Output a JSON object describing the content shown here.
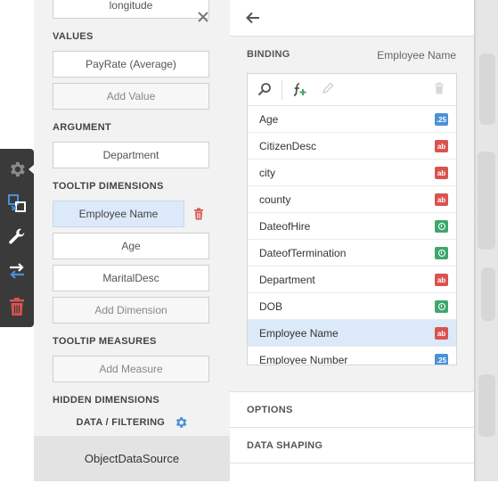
{
  "left_panel": {
    "top_field": "longitude",
    "values_header": "VALUES",
    "values_field": "PayRate (Average)",
    "add_value": "Add Value",
    "argument_header": "ARGUMENT",
    "argument_field": "Department",
    "tooltip_dimensions_header": "TOOLTIP DIMENSIONS",
    "tooltip_dimensions": [
      "Employee Name",
      "Age",
      "MaritalDesc"
    ],
    "add_dimension": "Add Dimension",
    "tooltip_measures_header": "TOOLTIP MEASURES",
    "add_measure": "Add Measure",
    "hidden_dimensions_header": "HIDDEN DIMENSIONS",
    "data_filtering": "DATA / FILTERING",
    "data_source": "ObjectDataSource"
  },
  "right_panel": {
    "binding_header": "BINDING",
    "binding_value": "Employee Name",
    "fields": [
      {
        "name": "Age",
        "type": "num",
        "badge": ".25"
      },
      {
        "name": "CitizenDesc",
        "type": "ab",
        "badge": "ab"
      },
      {
        "name": "city",
        "type": "ab",
        "badge": "ab"
      },
      {
        "name": "county",
        "type": "ab",
        "badge": "ab"
      },
      {
        "name": "DateofHire",
        "type": "date",
        "badge": ""
      },
      {
        "name": "DateofTermination",
        "type": "date",
        "badge": ""
      },
      {
        "name": "Department",
        "type": "ab",
        "badge": "ab"
      },
      {
        "name": "DOB",
        "type": "date",
        "badge": ""
      },
      {
        "name": "Employee Name",
        "type": "ab",
        "badge": "ab",
        "selected": true
      },
      {
        "name": "Employee Number",
        "type": "num",
        "badge": ".25"
      }
    ],
    "options_header": "OPTIONS",
    "data_shaping_header": "DATA SHAPING"
  },
  "colors": {
    "accent_blue": "#4a90d9",
    "selected_bg": "#dce9f8",
    "delete_red": "#d9534f",
    "date_green": "#3fa76b",
    "toolbar_dark": "#3a3a3a"
  },
  "icons": [
    "gear-icon",
    "layers-icon",
    "wrench-icon",
    "swap-icon",
    "trash-icon",
    "close-icon",
    "back-arrow-icon",
    "search-icon",
    "add-calculated-field-icon",
    "edit-icon"
  ]
}
